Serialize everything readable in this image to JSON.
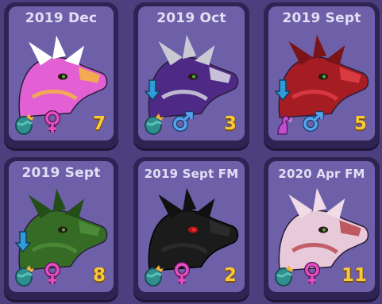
{
  "cards": [
    {
      "title": "2019 Dec",
      "count": "7",
      "gender": "female",
      "age": "newborn",
      "arrow": false,
      "pet": "pink-white dragon",
      "colors": {
        "head": "#e25fd4",
        "accent": "#f6b93a",
        "horn": "#ffffff"
      }
    },
    {
      "title": "2019 Oct",
      "count": "3",
      "gender": "male",
      "age": "newborn",
      "arrow": true,
      "pet": "purple-silver dragon",
      "colors": {
        "head": "#4e2a86",
        "accent": "#dcdce6",
        "horn": "#c9c9d4"
      }
    },
    {
      "title": "2019 Sept",
      "count": "5",
      "gender": "male",
      "age": "baby",
      "arrow": true,
      "pet": "red dragon",
      "colors": {
        "head": "#a51d22",
        "accent": "#e34047",
        "horn": "#7a1418"
      }
    },
    {
      "title": "2019 Sept",
      "count": "8",
      "gender": "female",
      "age": "newborn",
      "arrow": true,
      "pet": "green mossy dragon",
      "colors": {
        "head": "#356b25",
        "accent": "#4f8f3a",
        "horn": "#244e19"
      }
    },
    {
      "title": "2019 Sept FM",
      "count": "2",
      "gender": "female",
      "age": "newborn",
      "arrow": false,
      "pet": "black dragon",
      "colors": {
        "head": "#1b1b1b",
        "accent": "#2e2e2e",
        "horn": "#111111"
      }
    },
    {
      "title": "2020 Apr FM",
      "count": "11",
      "gender": "female",
      "age": "newborn",
      "arrow": false,
      "pet": "pale pink dragon",
      "colors": {
        "head": "#e7c9da",
        "accent": "#b7454b",
        "horn": "#f0dbe7"
      }
    }
  ],
  "accent_colors": {
    "count": "#f8c93f",
    "female": "#e44ec3",
    "male": "#58a4ec",
    "arrow": "#2f9bd9",
    "title": "#e3def5"
  }
}
